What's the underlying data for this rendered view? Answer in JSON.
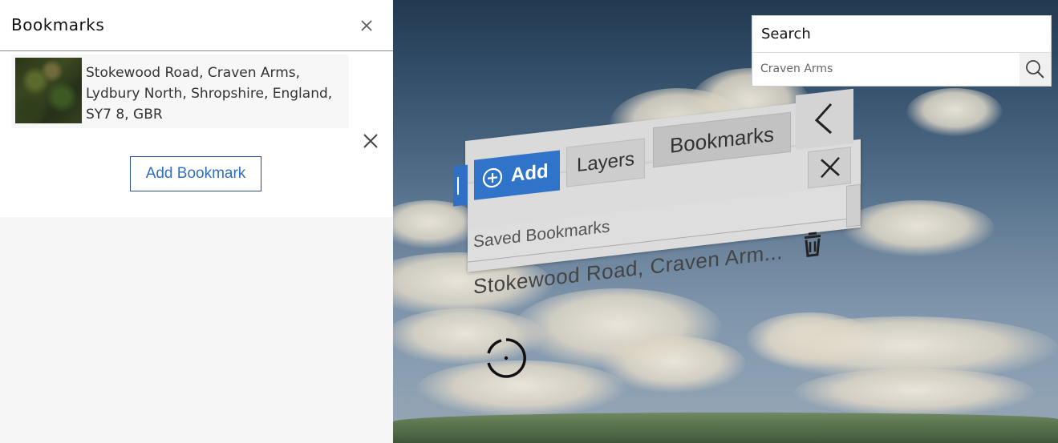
{
  "left_panel": {
    "title": "Bookmarks",
    "bookmarks": [
      {
        "label": "Stokewood Road, Craven Arms, Lydbury North, Shropshire, England, SY7 8, GBR"
      }
    ],
    "add_button_label": "Add Bookmark"
  },
  "search": {
    "title": "Search",
    "value": "Craven Arms"
  },
  "vr_menu": {
    "add_label": "Add",
    "layers_label": "Layers",
    "bookmarks_label": "Bookmarks",
    "section_title": "Saved Bookmarks",
    "items": [
      {
        "label": "Stokewood Road, Craven Arm..."
      }
    ]
  },
  "colors": {
    "accent_blue": "#2f74c8",
    "button_border": "#2b4e9a",
    "button_text": "#2f6fc0"
  },
  "icons": [
    "close-icon",
    "search-icon",
    "plus-circle-icon",
    "chevron-left-icon",
    "trash-icon",
    "reticle-icon"
  ]
}
